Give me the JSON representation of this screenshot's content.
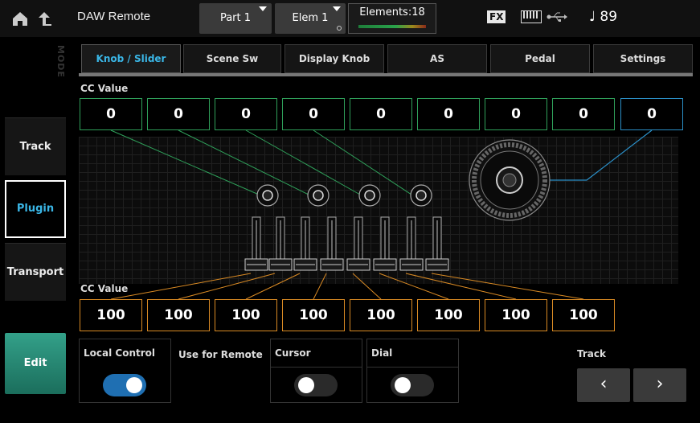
{
  "header": {
    "title": "DAW Remote",
    "part_button": "Part 1",
    "element_button": "Elem 1",
    "elements_label": "Elements:18",
    "fx_badge": "FX",
    "tempo": "♩ 89"
  },
  "sidebar": {
    "mode_label": "MODE",
    "items": [
      {
        "label": "Track",
        "active": false
      },
      {
        "label": "Plugin",
        "active": true
      },
      {
        "label": "Transport",
        "active": false
      }
    ],
    "edit_label": "Edit"
  },
  "tabs": [
    {
      "label": "Knob / Slider",
      "active": true
    },
    {
      "label": "Scene Sw",
      "active": false
    },
    {
      "label": "Display Knob",
      "active": false
    },
    {
      "label": "AS",
      "active": false
    },
    {
      "label": "Pedal",
      "active": false
    },
    {
      "label": "Settings",
      "active": false
    }
  ],
  "knob_section": {
    "label": "CC Value",
    "values": [
      "0",
      "0",
      "0",
      "0",
      "0",
      "0",
      "0",
      "0",
      "0"
    ]
  },
  "slider_section": {
    "label": "CC Value",
    "values": [
      "100",
      "100",
      "100",
      "100",
      "100",
      "100",
      "100",
      "100"
    ]
  },
  "bottom": {
    "local_control_label": "Local Control",
    "local_control_on": true,
    "use_for_remote_label": "Use for Remote",
    "cursor_label": "Cursor",
    "cursor_on": false,
    "dial_label": "Dial",
    "dial_on": false,
    "track_label": "Track",
    "prev_glyph": "‹",
    "next_glyph": "›"
  },
  "colors": {
    "accent_blue": "#3ab6e6",
    "knob_line_green": "#2fa05a",
    "dial_line_blue": "#2b8fc7",
    "slider_line_orange": "#d98a24",
    "toggle_on": "#1f6fb2",
    "edit_button": "#1b6e5c"
  }
}
